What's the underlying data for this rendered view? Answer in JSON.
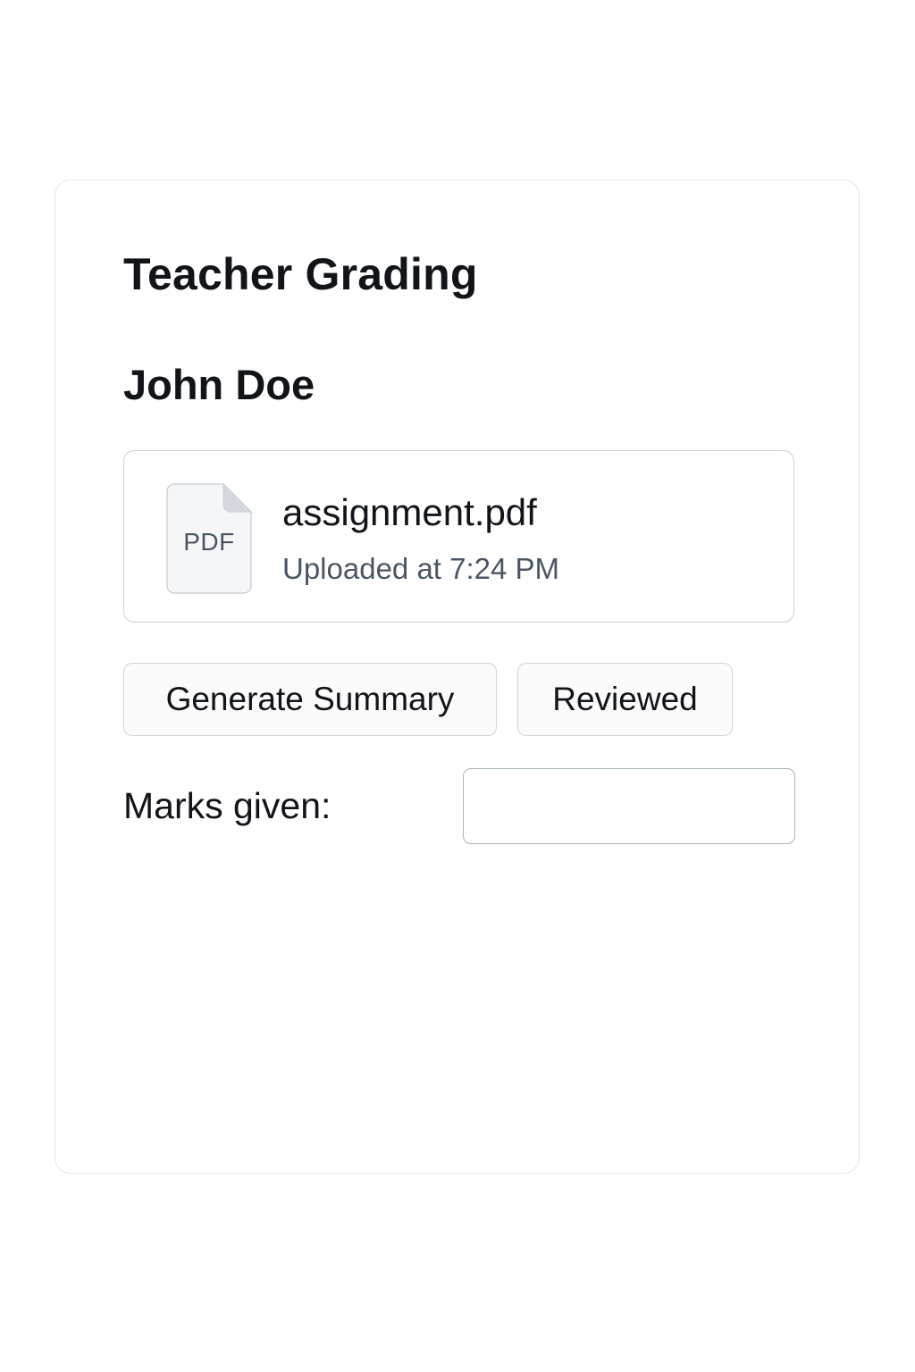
{
  "header": {
    "title": "Teacher Grading"
  },
  "student": {
    "name": "John Doe"
  },
  "submission": {
    "icon": "pdf-file-icon",
    "icon_label": "PDF",
    "file_name": "assignment.pdf",
    "uploaded": "Uploaded at 7:24 PM"
  },
  "actions": {
    "generate_summary_label": "Generate Summary",
    "reviewed_label": "Reviewed"
  },
  "grading": {
    "marks_label": "Marks given:",
    "marks_value": "",
    "marks_placeholder": ""
  },
  "colors": {
    "card_border": "#e3e6ea",
    "file_card_border": "#c9d0d7",
    "button_background": "#fbfbfc",
    "muted_text": "#4b5663"
  }
}
